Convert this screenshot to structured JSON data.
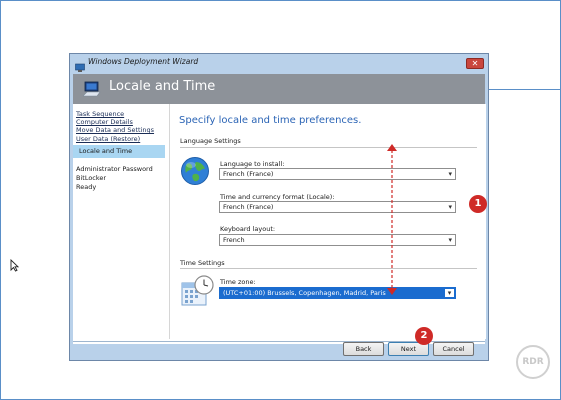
{
  "window": {
    "title": "Windows Deployment Wizard",
    "close_glyph": "✕"
  },
  "banner": {
    "title": "Locale and Time"
  },
  "nav": {
    "items": [
      {
        "label": "Task Sequence",
        "state": "completed"
      },
      {
        "label": "Computer Details",
        "state": "completed"
      },
      {
        "label": "Move Data and Settings",
        "state": "completed"
      },
      {
        "label": "User Data (Restore)",
        "state": "completed"
      },
      {
        "label": "Locale and Time",
        "state": "selected"
      },
      {
        "label": "Administrator Password",
        "state": "pending"
      },
      {
        "label": "BitLocker",
        "state": "pending"
      },
      {
        "label": "Ready",
        "state": "pending"
      }
    ]
  },
  "content": {
    "heading": "Specify locale and time preferences.",
    "language_section": {
      "label": "Language Settings",
      "language_to_install": {
        "label": "Language to install:",
        "value": "French (France)"
      },
      "locale": {
        "label": "Time and currency format (Locale):",
        "value": "French (France)"
      },
      "keyboard": {
        "label": "Keyboard layout:",
        "value": "French"
      }
    },
    "time_section": {
      "label": "Time Settings",
      "time_zone": {
        "label": "Time zone:",
        "value": "(UTC+01:00) Brussels, Copenhagen, Madrid, Paris"
      }
    }
  },
  "annotations": {
    "badge_1": "1",
    "badge_2": "2",
    "color": "#cf2a27"
  },
  "buttons": {
    "back": "Back",
    "next": "Next",
    "cancel": "Cancel"
  },
  "watermark": "RDR",
  "icons": {
    "title": "wizard-app-icon",
    "banner": "computer-icon",
    "language": "globe-icon",
    "time": "calendar-clock-icon",
    "cursor": "mouse-pointer-icon"
  }
}
